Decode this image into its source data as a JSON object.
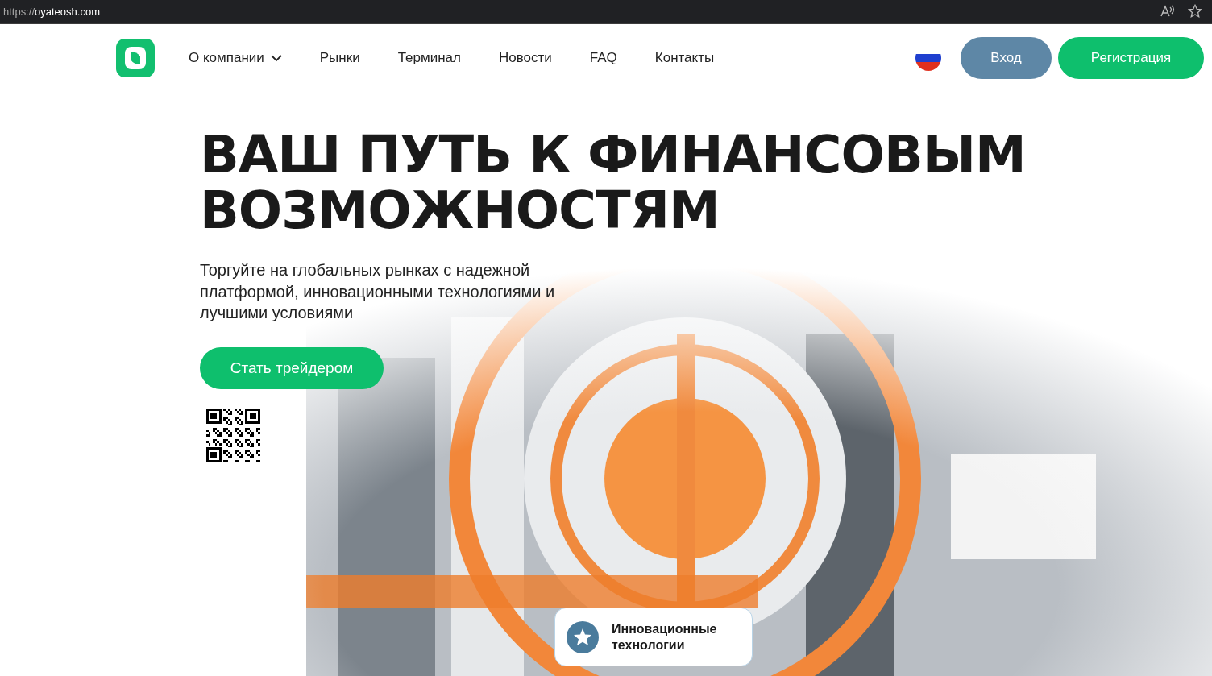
{
  "browser": {
    "url": {
      "scheme": "https://",
      "host": "oyateosh.com"
    }
  },
  "nav": {
    "items": [
      {
        "label": "О компании",
        "dropdown": true
      },
      {
        "label": "Рынки",
        "dropdown": false
      },
      {
        "label": "Терминал",
        "dropdown": false
      },
      {
        "label": "Новости",
        "dropdown": false
      },
      {
        "label": "FAQ",
        "dropdown": false
      },
      {
        "label": "Контакты",
        "dropdown": false
      }
    ],
    "login": "Вход",
    "register": "Регистрация"
  },
  "hero": {
    "title": "ВАШ ПУТЬ К ФИНАНСОВЫМ ВОЗМОЖНОСТЯМ",
    "subtitle": "Торгуйте на глобальных рынках с надежной платформой, инновационными технологиями и лучшими условиями",
    "cta": "Стать трейдером"
  },
  "feature": {
    "label": "Инновационные технологии"
  }
}
